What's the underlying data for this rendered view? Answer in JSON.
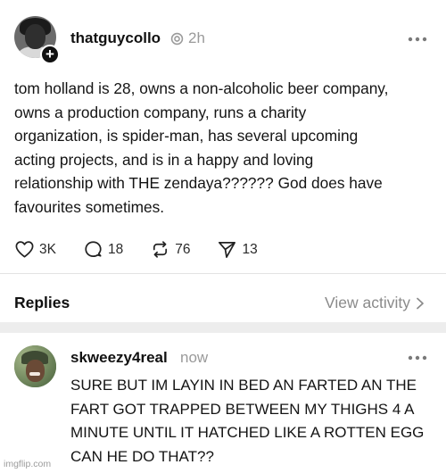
{
  "post": {
    "username": "thatguycollo",
    "time": "2h",
    "text": "tom holland is 28, owns a non-alcoholic beer company, owns a production company, runs a charity organization, is spider-man, has several upcoming acting projects, and is in a happy and loving relationship with THE zendaya?????? God does have favourites sometimes.",
    "actions": {
      "likes": "3K",
      "comments": "18",
      "reposts": "76",
      "shares": "13"
    }
  },
  "replies_bar": {
    "label": "Replies",
    "view_activity": "View activity"
  },
  "reply": {
    "username": "skweezy4real",
    "time": "now",
    "text": "SURE BUT IM LAYIN IN BED AN FARTED AN THE FART GOT TRAPPED BETWEEN MY THIGHS 4 A MINUTE UNTIL IT HATCHED LIKE A ROTTEN EGG CAN HE DO THAT??"
  },
  "watermark": "imgflip.com",
  "icons": {
    "verified": "verified-badge-icon",
    "more": "more-dots-icon",
    "like": "heart-icon",
    "comment": "comment-bubble-icon",
    "repost": "repost-icon",
    "share": "send-icon",
    "chevron": "chevron-right-icon",
    "follow": "plus-icon"
  },
  "colors": {
    "text": "#101010",
    "muted": "#9a9a9a",
    "divider": "#e3e3e3",
    "separator": "#ededed"
  }
}
